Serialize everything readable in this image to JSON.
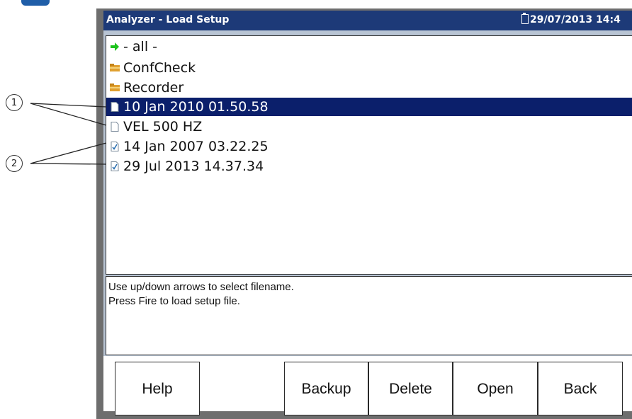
{
  "window": {
    "title": "Analyzer - Load Setup",
    "status": "29/07/2013 14:4"
  },
  "file_list": {
    "items": [
      {
        "label": "- all -",
        "icon": "green-arrow-icon",
        "selected": false
      },
      {
        "label": "ConfCheck",
        "icon": "folder-icon",
        "selected": false
      },
      {
        "label": "Recorder",
        "icon": "folder-icon",
        "selected": false
      },
      {
        "label": "10 Jan 2010 01.50.58",
        "icon": "document-icon",
        "selected": true
      },
      {
        "label": "VEL 500 HZ",
        "icon": "document-icon",
        "selected": false
      },
      {
        "label": "14 Jan 2007 03.22.25",
        "icon": "checked-document-icon",
        "selected": false
      },
      {
        "label": "29 Jul 2013 14.37.34",
        "icon": "checked-document-icon",
        "selected": false
      }
    ]
  },
  "message": {
    "line1": "Use up/down arrows to select filename.",
    "line2": "Press Fire to load setup file."
  },
  "buttons": {
    "help": "Help",
    "backup": "Backup",
    "delete": "Delete",
    "open": "Open",
    "back": "Back"
  },
  "callouts": {
    "one": "1",
    "two": "2"
  },
  "colors": {
    "titlebar": "#1d3a78",
    "selection": "#0b1f6b",
    "pane": "#b8c4d3",
    "folder": "#e0a030",
    "arrow": "#1cc21c"
  }
}
